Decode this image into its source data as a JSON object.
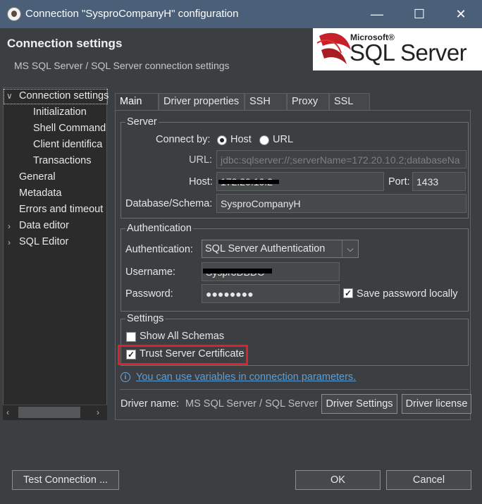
{
  "window": {
    "title": "Connection \"SysproCompanyH\" configuration",
    "minimize_glyph": "—",
    "maximize_glyph": "☐",
    "close_glyph": "✕"
  },
  "header": {
    "title": "Connection settings",
    "subtitle": "MS SQL Server / SQL Server connection settings",
    "logo_microsoft": "Microsoft®",
    "logo_product": "SQL Server"
  },
  "sidebar": {
    "items": [
      {
        "label": "Connection settings",
        "expanded": true
      },
      {
        "label": "Initialization"
      },
      {
        "label": "Shell Command"
      },
      {
        "label": "Client identifica"
      },
      {
        "label": "Transactions"
      },
      {
        "label": "General"
      },
      {
        "label": "Metadata"
      },
      {
        "label": "Errors and timeout"
      },
      {
        "label": "Data editor",
        "expandable": true
      },
      {
        "label": "SQL Editor",
        "expandable": true
      }
    ]
  },
  "tabs": [
    "Main",
    "Driver properties",
    "SSH",
    "Proxy",
    "SSL"
  ],
  "server": {
    "legend": "Server",
    "connect_by_label": "Connect by:",
    "option_host": "Host",
    "option_url": "URL",
    "selected": "Host",
    "url_label": "URL:",
    "url_value": "jdbc:sqlserver://;serverName=172.20.10.2;databaseNa",
    "host_label": "Host:",
    "host_value": "172.20.10.2",
    "port_label": "Port:",
    "port_value": "1433",
    "db_label": "Database/Schema:",
    "db_value": "SysproCompanyH"
  },
  "auth": {
    "legend": "Authentication",
    "auth_label": "Authentication:",
    "auth_value": "SQL Server Authentication",
    "username_label": "Username:",
    "username_value": "SysproDBDC",
    "password_label": "Password:",
    "password_value": "●●●●●●●●",
    "save_password_label": "Save password locally",
    "save_password_checked": true
  },
  "settings": {
    "legend": "Settings",
    "show_all_schemas": "Show All Schemas",
    "show_all_schemas_checked": false,
    "trust_cert": "Trust Server Certificate",
    "trust_cert_checked": true
  },
  "info_link": "You can use variables in connection parameters.",
  "driver": {
    "label": "Driver name:",
    "value": "MS SQL Server / SQL Server",
    "settings_button": "Driver Settings",
    "license_button": "Driver license"
  },
  "footer": {
    "test_connection": "Test Connection ...",
    "ok": "OK",
    "cancel": "Cancel"
  },
  "colors": {
    "titlebar": "#4b6078",
    "background": "#3c3f41",
    "highlight_border": "#e0202a",
    "link": "#5c9fd6"
  }
}
